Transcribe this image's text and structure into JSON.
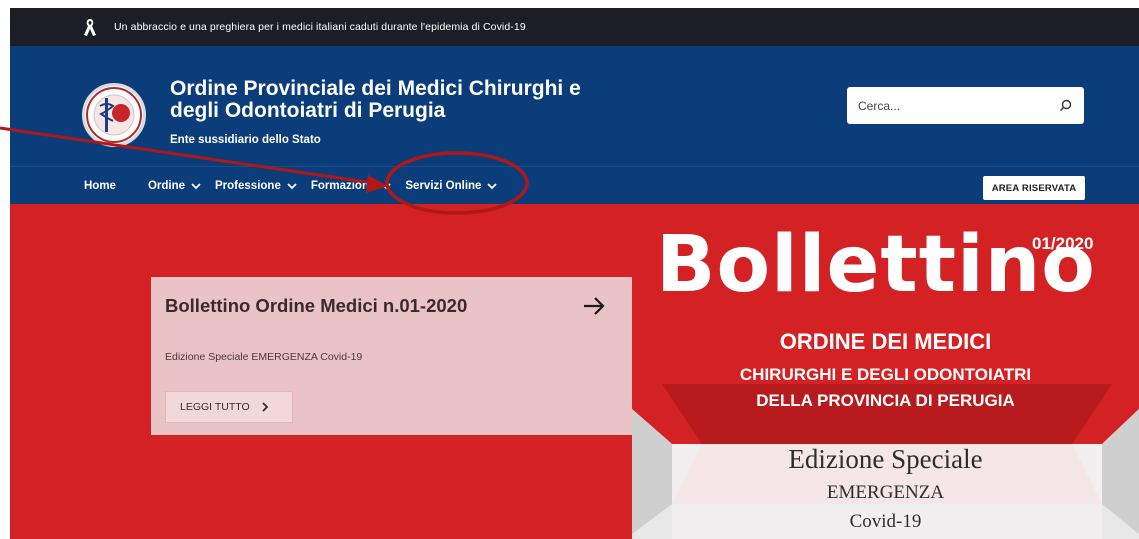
{
  "notice": {
    "text": "Un abbraccio e una preghiera per i medici italiani caduti durante l'epidemia di Covid-19",
    "icon": "ribbon-icon"
  },
  "header": {
    "title_line1": "Ordine Provinciale dei Medici Chirurghi e",
    "title_line2": "degli Odontoiatri di Perugia",
    "subtitle": "Ente sussidiario dello Stato",
    "logo_icon": "order-seal-logo",
    "search_placeholder": "Cerca...",
    "search_icon": "search-icon"
  },
  "nav": {
    "items": [
      {
        "label": "Home",
        "has_dropdown": false
      },
      {
        "label": "Ordine",
        "has_dropdown": true
      },
      {
        "label": "Professione",
        "has_dropdown": true
      },
      {
        "label": "Formazione",
        "has_dropdown": true
      },
      {
        "label": "Servizi Online",
        "has_dropdown": true
      }
    ],
    "area_button": "AREA RISERVATA"
  },
  "hero": {
    "card_title": "Bollettino Ordine Medici n.01-2020",
    "card_description": "Edizione Speciale EMERGENZA Covid-19",
    "read_more": "LEGGI TUTTO",
    "cover": {
      "word": "Bollettino",
      "number": "01/2020",
      "line1": "ORDINE DEI MEDICI",
      "line2": "CHIRURGHI E DEGLI ODONTOIATRI",
      "line3": "DELLA PROVINCIA DI PERUGIA",
      "line4": "Edizione Speciale",
      "line5": "EMERGENZA",
      "line6": "Covid-19"
    }
  },
  "colors": {
    "notice_bg": "#1b1f25",
    "header_bg": "#0a3d7a",
    "hero_red": "#d42124",
    "card_bg": "#e9c3c5",
    "annotation": "#b01818"
  }
}
